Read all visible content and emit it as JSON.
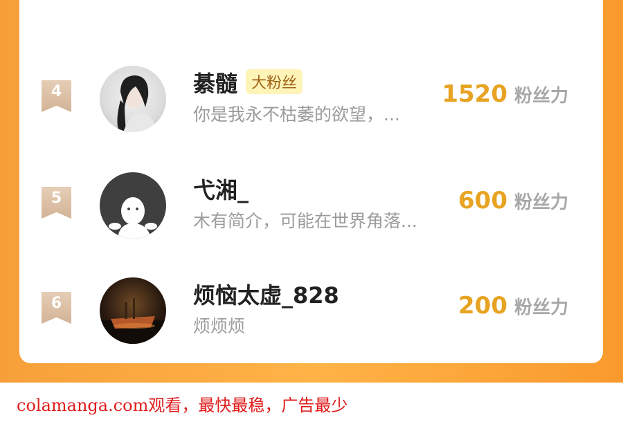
{
  "ranking": [
    {
      "rank": "4",
      "name": "綦髓",
      "badge": "大粉丝",
      "bio": "你是我永不枯萎的欲望，...",
      "score": "1520",
      "unit": "粉丝力"
    },
    {
      "rank": "5",
      "name": "弋湘_",
      "badge": "",
      "bio": "木有简介，可能在世界角落...",
      "score": "600",
      "unit": "粉丝力"
    },
    {
      "rank": "6",
      "name": "烦恼太虚_828",
      "badge": "",
      "bio": "烦烦烦",
      "score": "200",
      "unit": "粉丝力"
    }
  ],
  "footer": {
    "text": "colamanga.com观看，最快最稳，广告最少"
  },
  "colors": {
    "accent": "#f7a03a",
    "score": "#e7a322",
    "footer": "#e01c1c"
  },
  "icons": [
    "rank-ribbon-icon",
    "default-avatar-icon"
  ]
}
